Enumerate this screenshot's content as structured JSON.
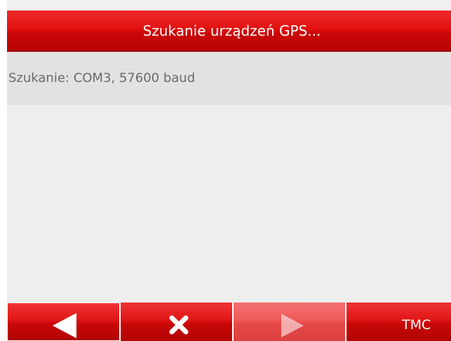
{
  "header": {
    "title": "Szukanie urządzeń GPS..."
  },
  "status": {
    "text": "Szukanie: COM3, 57600 baud"
  },
  "toolbar": {
    "back_icon": "left-arrow-icon",
    "cancel_icon": "close-icon",
    "next_icon": "right-arrow-icon",
    "next_enabled": false,
    "tmc_label": "TMC"
  },
  "colors": {
    "accent": "#e01616",
    "disabled_button": "#ee5a5a",
    "background": "#eeeeee",
    "status_band": "#e2e2e2",
    "status_text": "#6a6a6a"
  }
}
